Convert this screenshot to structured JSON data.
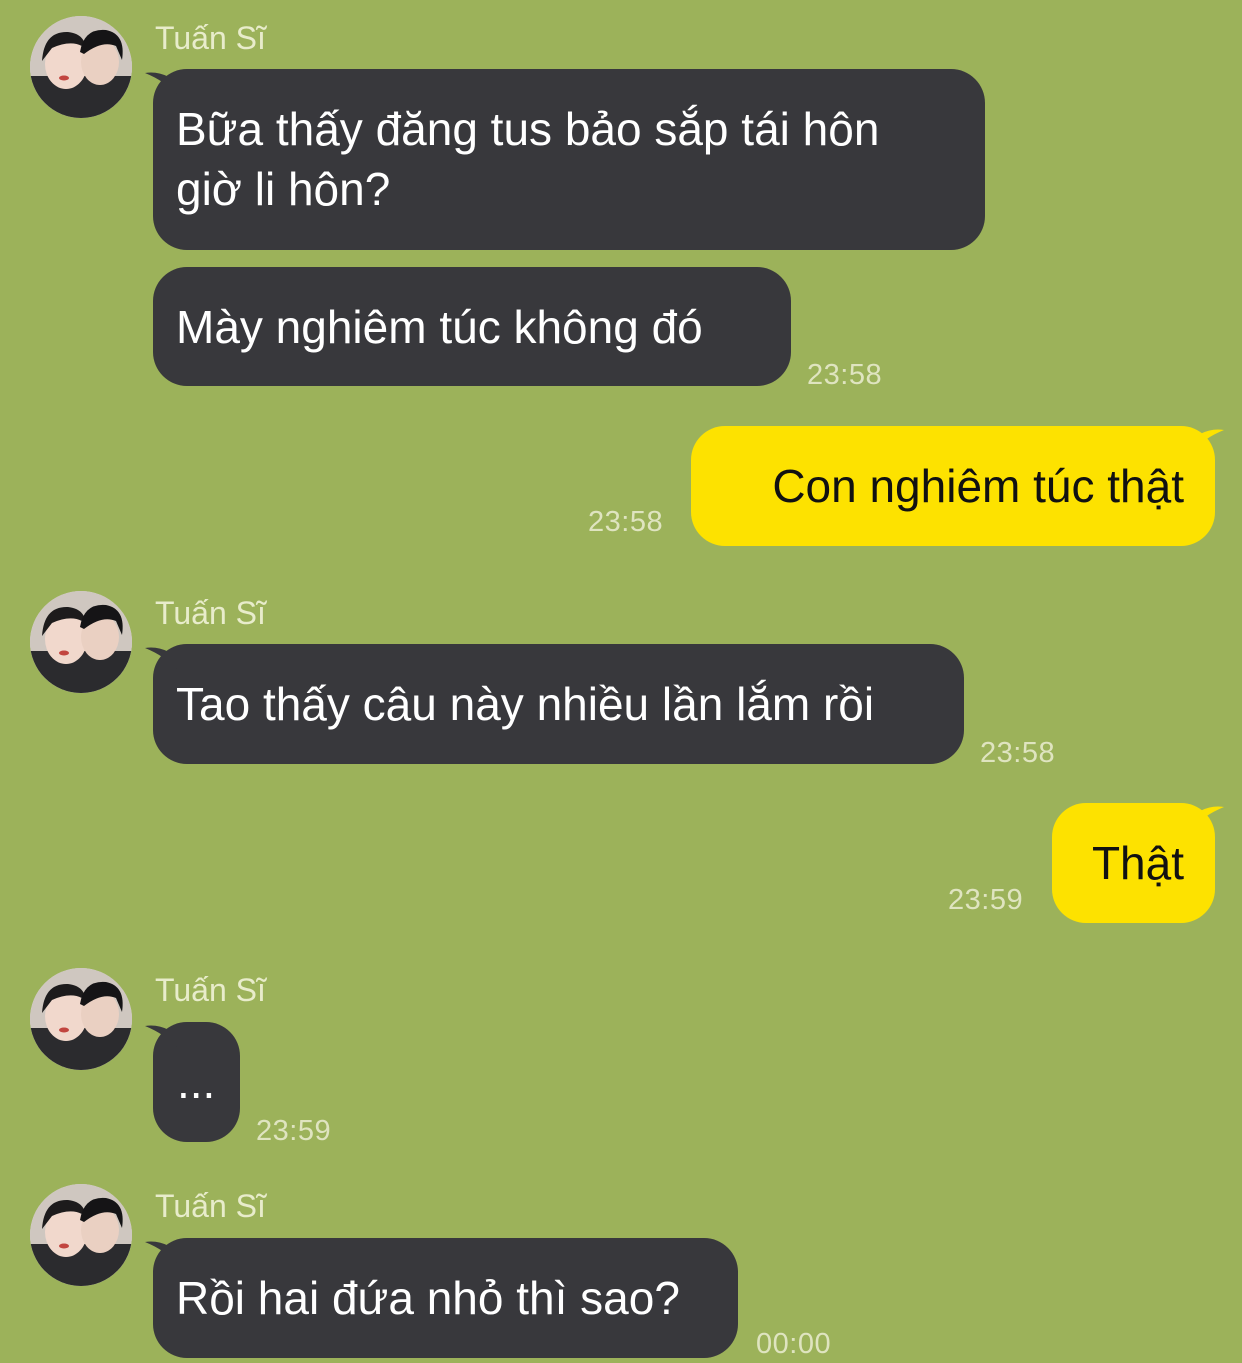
{
  "contact": {
    "name": "Tuấn Sĩ"
  },
  "colors": {
    "background": "#9cb25a",
    "incoming_bubble": "#38383c",
    "outgoing_bubble": "#fde200"
  },
  "messages": [
    {
      "direction": "incoming",
      "lines": [
        "Bữa thấy đăng tus bảo sắp tái hôn",
        "giờ li hôn?"
      ]
    },
    {
      "direction": "incoming",
      "text": "Mày nghiêm túc không đó",
      "time": "23:58"
    },
    {
      "direction": "outgoing",
      "text": "Con nghiêm túc thật",
      "time": "23:58"
    },
    {
      "direction": "incoming",
      "text": "Tao thấy câu này nhiều lần lắm rồi",
      "time": "23:58"
    },
    {
      "direction": "outgoing",
      "text": "Thật",
      "time": "23:59"
    },
    {
      "direction": "incoming",
      "text": "...",
      "time": "23:59"
    },
    {
      "direction": "incoming",
      "text": "Rồi hai đứa nhỏ thì sao?",
      "time": "00:00"
    }
  ],
  "icons": {
    "avatar": "contact-photo-avatar",
    "bubble_tail": "speech-bubble-tail"
  }
}
